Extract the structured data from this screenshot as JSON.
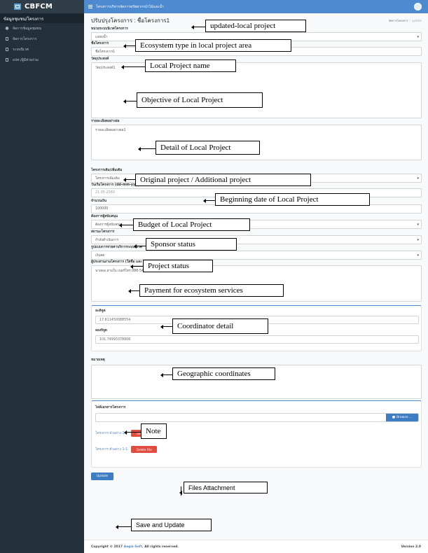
{
  "app": {
    "brand": "CBFCM",
    "topbar_title": "โครงการบริหารจัดการทรัพยากรป่าไม้และน้ำ"
  },
  "sidebar": {
    "header": "ข้อมูลชุมชน/โครงการ",
    "items": [
      {
        "icon": "users-icon",
        "label": "จัดการข้อมูลชุมชน"
      },
      {
        "icon": "document-icon",
        "label": "จัดการโครงการ"
      },
      {
        "icon": "document-icon",
        "label": "ระบบนิเวศ"
      },
      {
        "icon": "document-icon",
        "label": "อปท./ผู้มีส่วนร่วม"
      }
    ]
  },
  "page": {
    "title": "ปรับปรุงโครงการ : ชื่อโครงการ1",
    "breadcrumb": [
      "จัดการโครงการ",
      "update"
    ]
  },
  "form": {
    "ecosystem": {
      "label": "หน่วยระบบนิเวศโครงการ",
      "value": "แหล่งน้ำ"
    },
    "project_name": {
      "label": "ชื่อโครงการ",
      "value": "ชื่อโครงการ1"
    },
    "objective": {
      "label": "วัตถุประสงค์",
      "value": "วัตถุประสงค์1"
    },
    "detail": {
      "label": "รายละเอียดอย่างย่อ",
      "value": "รายละเอียดอย่างย่อ1"
    },
    "project_type": {
      "label": "โครงการเดิม/เพิ่มเติม",
      "value": "โครงการเพิ่มเติม"
    },
    "begin_date": {
      "label": "วันเริ่มโครงการ (dd-mm-yyyy) ตัวอย่างเช่น 14-05-2560",
      "value": "21-05-2560"
    },
    "budget": {
      "label": "จำนวนเงิน",
      "value": "100000"
    },
    "sponsor": {
      "label": "ต้องการผู้สนับสนุน",
      "value": "ต้องการผู้สนับสนุน"
    },
    "status": {
      "label": "สถานะโครงการ",
      "value": "กำลังดำเนินการ"
    },
    "payment": {
      "label": "รูปแบบการจ่ายค่าบริการระบบนิเวศ",
      "value": "เงินสด"
    },
    "coordinator": {
      "label": "ผู้ประสานงานโครงการ (ใส่ชื่อ และ เบอร์ติดต่อ)",
      "value": "นายพล สามใบ เบอร์โทร 086-5416325"
    },
    "latitude": {
      "label": "ละติจูด",
      "value": "17.611450088554"
    },
    "longitude": {
      "label": "ลองจิจูด",
      "value": "101.74993378806"
    },
    "note": {
      "label": "หมายเหตุ",
      "value": ""
    },
    "files": {
      "label": "ไฟล์เอกสารโครงการ",
      "browse_label": "Browse ...",
      "items": [
        {
          "name": "โครงการ ตัวอย่าง 1-2",
          "delete_label": "Delete File"
        },
        {
          "name": "โครงการ ตัวอย่าง 1-1",
          "delete_label": "Delete File"
        }
      ]
    },
    "update_label": "Update"
  },
  "footer": {
    "copyright_prefix": "Copyright © 2017 ",
    "company": "Aegis-Soft",
    "copyright_suffix": ". All rights reserved.",
    "version": "Version 2.0"
  },
  "annotations": {
    "title": "updated-local project",
    "ecosystem": "Ecosystem type in local project area",
    "name": "Local Project name",
    "objective": "Objective of Local Project",
    "detail": "Detail of Local Project",
    "type": "Original project / Additional project",
    "date": "Beginning date of Local Project",
    "budget": "Budget of Local Project",
    "sponsor": "Sponsor status",
    "status": "Project status",
    "payment": "Payment for ecosystem services",
    "coordinator": "Coordinator detail",
    "coordinates": "Geographic coordinates",
    "note": "Note",
    "files": "Files Attachment",
    "save": "Save and Update"
  }
}
